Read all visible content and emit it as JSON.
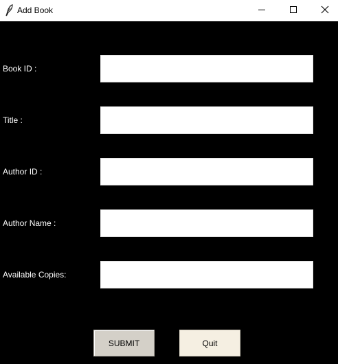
{
  "window": {
    "title": "Add Book"
  },
  "form": {
    "fields": [
      {
        "label": "Book ID :",
        "value": ""
      },
      {
        "label": "Title :",
        "value": ""
      },
      {
        "label": "Author ID :",
        "value": ""
      },
      {
        "label": "Author Name :",
        "value": ""
      },
      {
        "label": "Available Copies:",
        "value": ""
      }
    ],
    "submit_label": "SUBMIT",
    "quit_label": "Quit"
  },
  "colors": {
    "background": "#000000",
    "label_text": "#ffffff",
    "submit_button_bg": "#d4d0c8",
    "quit_button_bg": "#f5efe2"
  },
  "icons": {
    "app": "feather-icon",
    "minimize": "minimize-icon",
    "maximize": "maximize-icon",
    "close": "close-icon"
  }
}
